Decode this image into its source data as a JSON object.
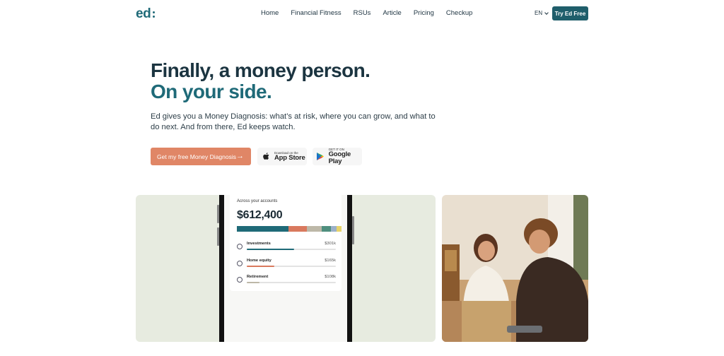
{
  "nav": {
    "logo": "ed",
    "links": [
      {
        "label": "Home"
      },
      {
        "label": "Financial Fitness"
      },
      {
        "label": "RSUs"
      },
      {
        "label": "Article"
      },
      {
        "label": "Pricing"
      },
      {
        "label": "Checkup"
      }
    ],
    "language": "EN",
    "cta": "Try Ed Free"
  },
  "hero": {
    "title_line1": "Finally, a money person.",
    "title_line2": "On your side.",
    "subtitle": "Ed gives you a Money Diagnosis: what’s at risk, where you can grow, and what to do next. And from there, Ed keeps watch.",
    "cta": "Get my free Money Diagnosis",
    "app_store": {
      "small": "Download on the",
      "big": "App Store"
    },
    "google_play": {
      "small": "GET IT ON",
      "big": "Google Play"
    }
  },
  "phone_card": {
    "label": "Across your accounts",
    "total": "$612,400",
    "stack_colors": [
      "#1f6a78",
      "#d9795e",
      "#bdb8a8",
      "#4f8f7e",
      "#9bb0c9",
      "#e7d36b"
    ],
    "stack_fractions": [
      0.49,
      0.18,
      0.14,
      0.09,
      0.05,
      0.05
    ],
    "rows": [
      {
        "name": "Investments",
        "value": "$301k",
        "fill_fraction": 0.53,
        "color": "#1f6a78"
      },
      {
        "name": "Home equity",
        "value": "$165k",
        "fill_fraction": 0.31,
        "color": "#d9795e"
      },
      {
        "name": "Retirement",
        "value": "$108k",
        "fill_fraction": 0.14,
        "color": "#bdb8a8"
      }
    ]
  },
  "colors": {
    "brand": "#1f6a78",
    "cta": "#e08666",
    "panel_bg": "#e7ebe0"
  }
}
